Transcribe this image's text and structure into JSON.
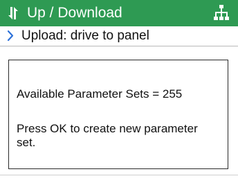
{
  "header": {
    "title": "Up / Download",
    "title_icon": "transfer-arrows-icon",
    "network_icon": "network-tree-icon",
    "background_color": "#2e9a53"
  },
  "breadcrumb": {
    "icon": "chevron-right-icon",
    "label": "Upload: drive to panel",
    "icon_color": "#2e72d9"
  },
  "message": {
    "line1": "Available Parameter Sets = 255",
    "line2": "Press OK to create new parameter set."
  }
}
